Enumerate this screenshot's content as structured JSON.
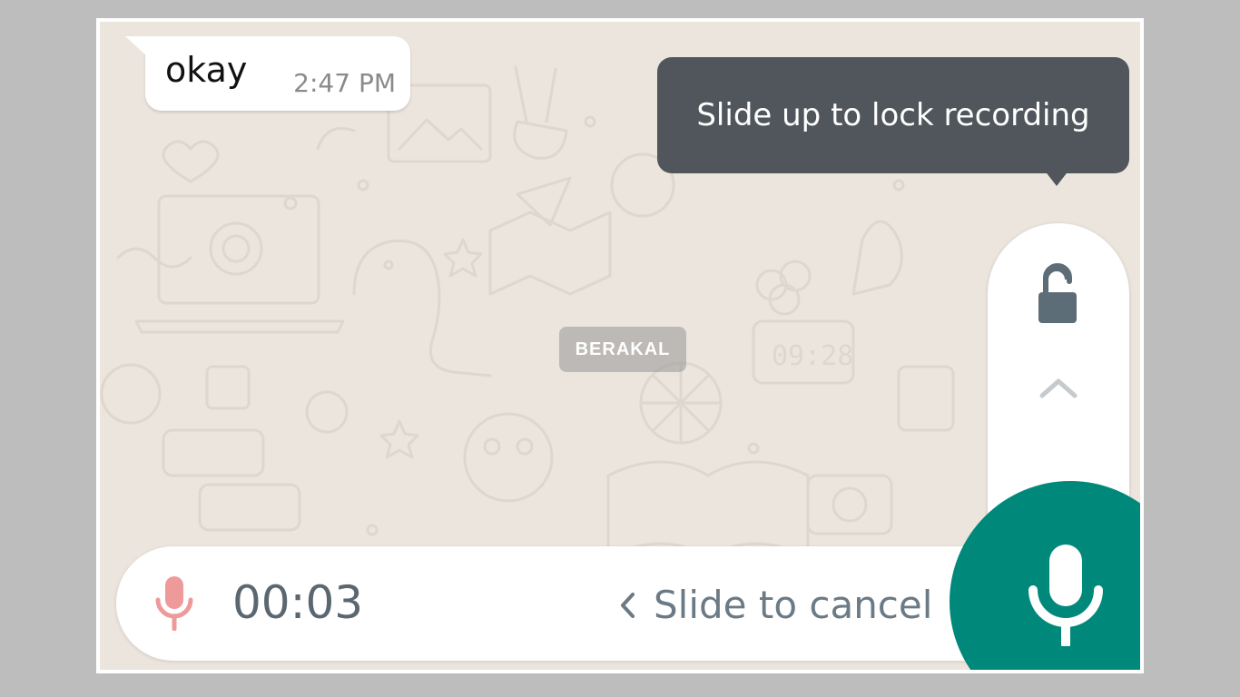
{
  "message": {
    "text": "okay",
    "time": "2:47 PM"
  },
  "tooltip": {
    "text": "Slide up to lock recording"
  },
  "lock_panel": {
    "lock_icon": "lock-open-icon",
    "hint_icon": "chevron-up-icon"
  },
  "watermark": {
    "text": "BERAKAL"
  },
  "recording": {
    "mic_icon": "mic-icon",
    "timer": "00:03",
    "cancel_hint": "Slide to cancel",
    "cancel_icon": "chevron-left-icon"
  },
  "mic_button": {
    "icon": "mic-icon"
  },
  "colors": {
    "chat_background": "#ece5dd",
    "tooltip_background": "#50565b",
    "accent_green": "#00897b",
    "recording_red": "#ef9a9a",
    "icon_grey": "#5d6d77"
  }
}
